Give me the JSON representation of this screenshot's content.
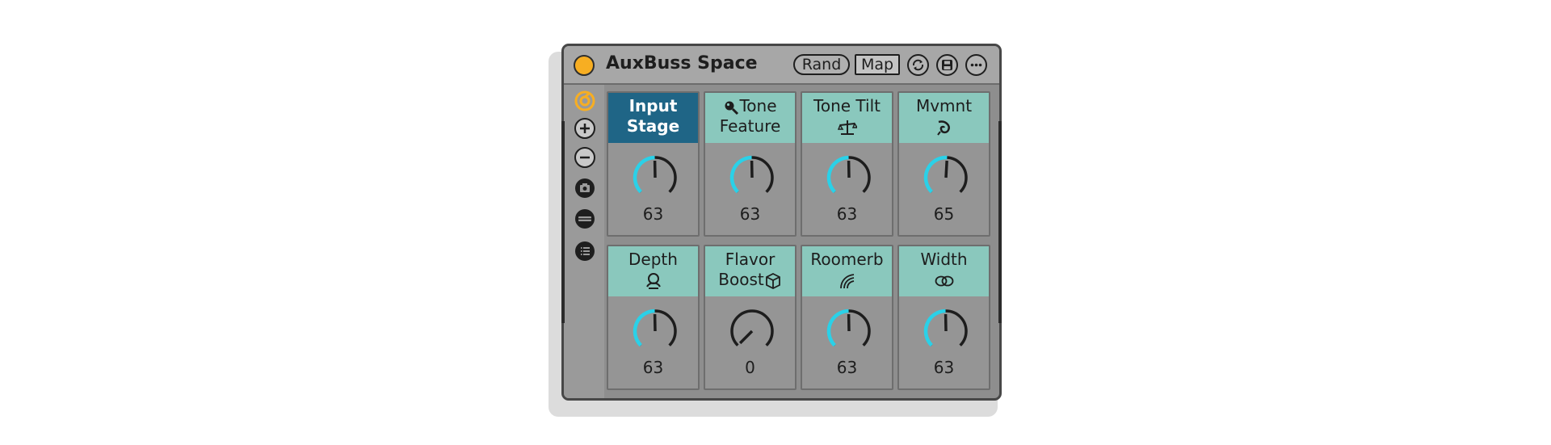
{
  "device": {
    "title": "AuxBuss Space",
    "power_color": "#f7ae22",
    "buttons": {
      "rand_label": "Rand",
      "map_label": "Map",
      "icons": [
        "refresh-icon",
        "save-icon",
        "more-icon"
      ]
    },
    "sidebar_icons": [
      "macro-variation-icon",
      "add-macro-icon",
      "remove-macro-icon",
      "snapshot-icon",
      "chain-icon",
      "list-icon"
    ]
  },
  "macros": [
    {
      "line1": "Input",
      "line2": "Stage",
      "value": "63",
      "level": 63,
      "selected": true,
      "icon": ""
    },
    {
      "line1": "Tone",
      "line2": "Feature",
      "value": "63",
      "level": 63,
      "selected": false,
      "icon": "magnifier-icon"
    },
    {
      "line1": "Tone Tilt",
      "line2": "",
      "value": "63",
      "level": 63,
      "selected": false,
      "icon": "tilt-icon"
    },
    {
      "line1": "Mvmnt",
      "line2": "",
      "value": "65",
      "level": 65,
      "selected": false,
      "icon": "swirl-icon"
    },
    {
      "line1": "Depth",
      "line2": "",
      "value": "63",
      "level": 63,
      "selected": false,
      "icon": "depth-icon"
    },
    {
      "line1": "Flavor",
      "line2": "Boost",
      "value": "0",
      "level": 0,
      "selected": false,
      "icon": "cube-icon"
    },
    {
      "line1": "Roomerb",
      "line2": "",
      "value": "63",
      "level": 63,
      "selected": false,
      "icon": "waves-icon"
    },
    {
      "line1": "Width",
      "line2": "",
      "value": "63",
      "level": 63,
      "selected": false,
      "icon": "rings-icon"
    }
  ],
  "colors": {
    "knob_arc": "#2ad1e8",
    "header_teal": "#8ac8bd",
    "header_selected": "#1f6586"
  }
}
